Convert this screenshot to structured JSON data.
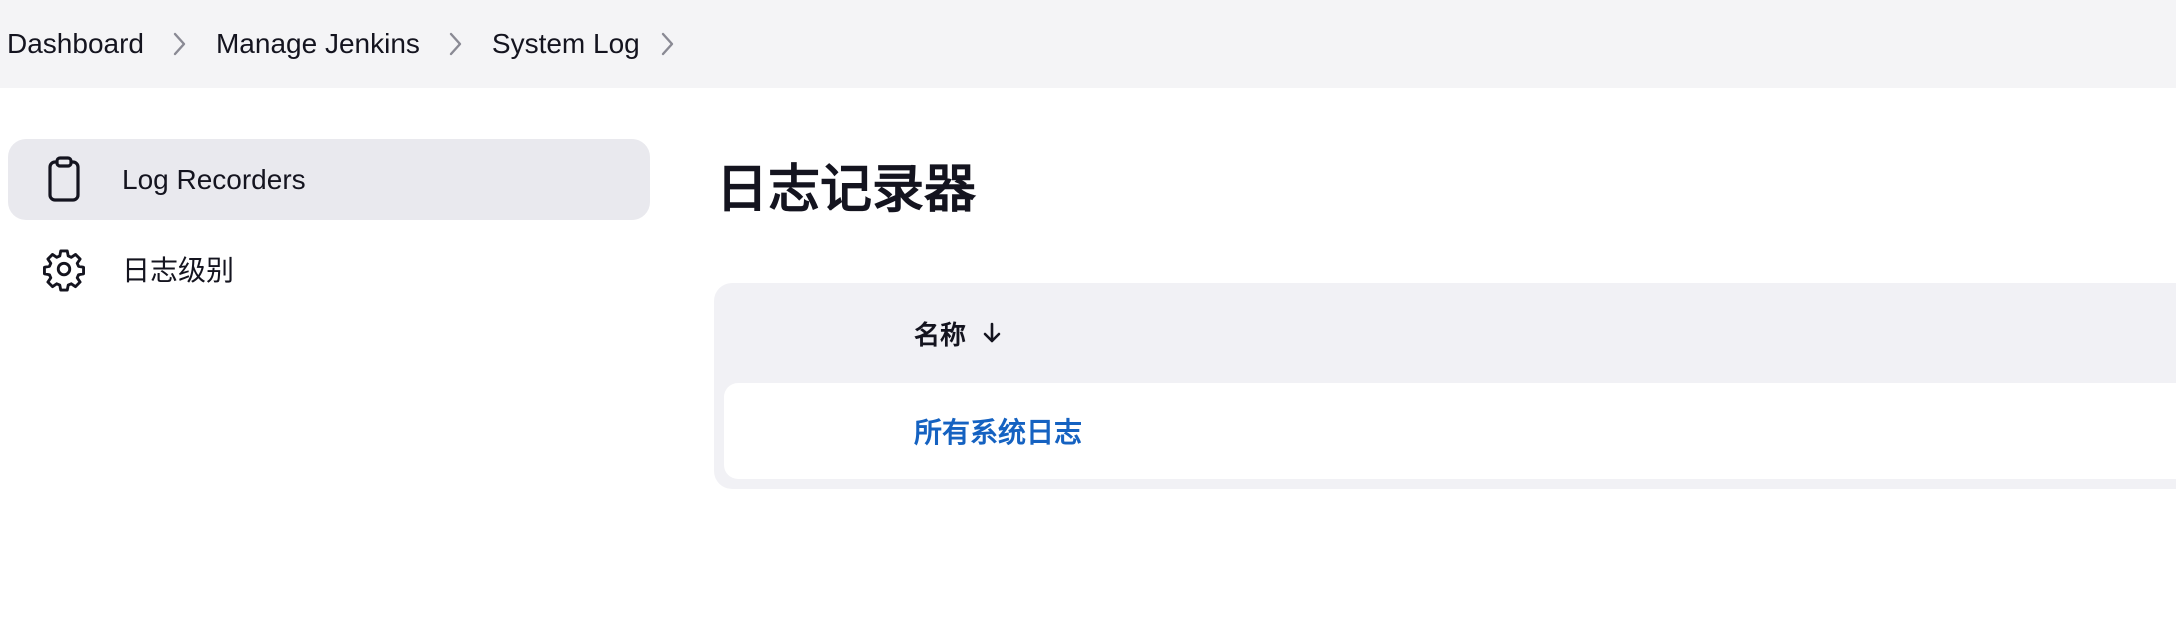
{
  "breadcrumb": {
    "items": [
      {
        "label": "Dashboard"
      },
      {
        "label": "Manage Jenkins"
      },
      {
        "label": "System Log"
      }
    ]
  },
  "sidebar": {
    "items": [
      {
        "label": "Log Recorders",
        "icon": "clipboard-icon",
        "active": true
      },
      {
        "label": "日志级别",
        "icon": "gear-icon",
        "active": false
      }
    ]
  },
  "main": {
    "title": "日志记录器",
    "table": {
      "header": {
        "name_label": "名称",
        "sort_icon": "arrow-down-icon"
      },
      "rows": [
        {
          "name": "所有系统日志"
        }
      ]
    }
  },
  "colors": {
    "breadcrumb_bg": "#f4f4f6",
    "active_item_bg": "#e9e9ee",
    "table_bg": "#f1f1f5",
    "link": "#1562c1",
    "text": "#14141f"
  }
}
